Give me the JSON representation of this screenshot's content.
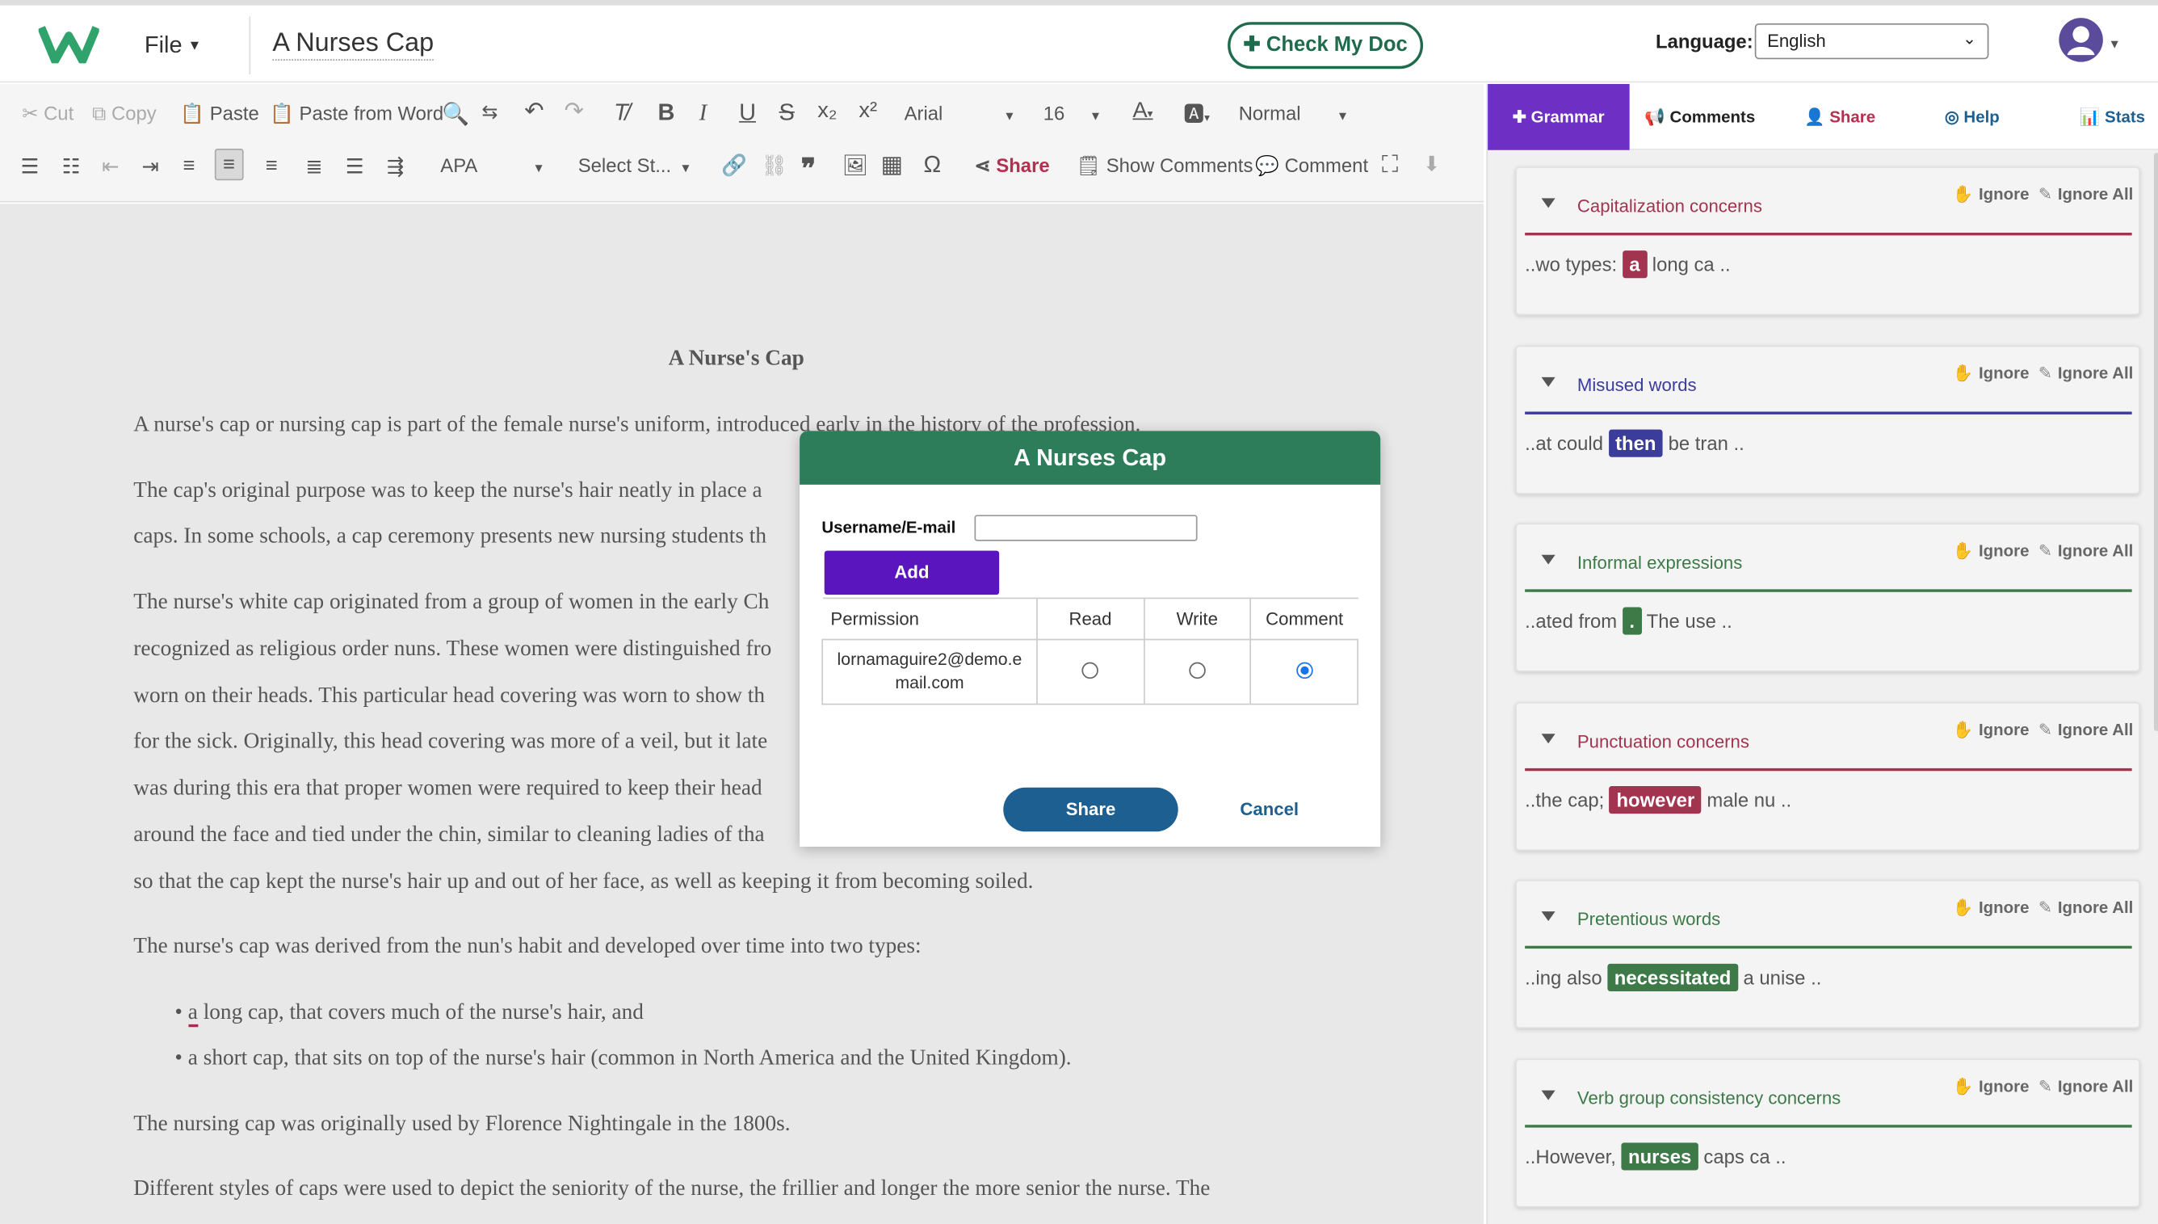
{
  "header": {
    "file_menu": "File",
    "doc_title": "A Nurses Cap",
    "check_button": "Check My Doc",
    "language_label": "Language:",
    "language_value": "English"
  },
  "toolbar": {
    "cut": "Cut",
    "copy": "Copy",
    "paste": "Paste",
    "paste_word": "Paste from Word",
    "font": "Arial",
    "size": "16",
    "style": "Normal",
    "citation": "APA",
    "select_style": "Select St...",
    "share": "Share",
    "show_comments": "Show Comments",
    "comment": "Comment"
  },
  "document": {
    "title": "A Nurse's Cap",
    "lines": [
      "A nurse's cap or nursing cap is part of the female nurse's uniform, introduced early in the history of the profession.",
      "The cap's original purpose was to keep the nurse's hair neatly in place a",
      "caps. In some schools, a cap ceremony presents new nursing students th",
      "The nurse's white cap originated from a group of women in the early Ch",
      "recognized as religious order nuns. These women were distinguished fro",
      "worn on their heads. This particular head covering was worn to show th",
      "for the sick. Originally, this head covering was more of a veil, but it late",
      "was during this era that proper women were required to keep their head",
      "around the face and tied under the chin, similar to cleaning ladies of tha",
      "so that the cap kept the nurse's hair up and out of her face, as well as keeping it from becoming soiled.",
      "The nurse's cap was derived from the nun's habit and developed over time into two types:"
    ],
    "bullet1_first": "a",
    "bullet1_rest": " long cap, that covers much of the nurse's hair, and",
    "bullet2": "a short cap, that sits on top of the nurse's hair (common in North America and the United Kingdom).",
    "line_nightingale": "The nursing cap was originally used by Florence Nightingale in the 1800s.",
    "line_last": "Different styles of caps were used to depict the seniority of the nurse, the frillier and longer the more senior the nurse. The"
  },
  "dialog": {
    "title": "A Nurses Cap",
    "username_label": "Username/E-mail",
    "username_value": "",
    "add_button": "Add",
    "columns": [
      "Permission",
      "Read",
      "Write",
      "Comment"
    ],
    "row_email": "lornamaguire2@demo.email.com",
    "row_email_line1": "lornamaguire2@demo.e",
    "row_email_line2": "mail.com",
    "selected_permission": "Comment",
    "share_button": "Share",
    "cancel_button": "Cancel"
  },
  "panel": {
    "tabs": {
      "grammar": "Grammar",
      "comments": "Comments",
      "share": "Share",
      "help": "Help",
      "stats": "Stats"
    },
    "ignore": "Ignore",
    "ignore_all": "Ignore All",
    "cards": [
      {
        "title": "Capitalization concerns",
        "before": "..wo types: ",
        "word": "a",
        "after": " long ca ..",
        "color": "#a2344f"
      },
      {
        "title": "Misused words",
        "before": "..at could ",
        "word": "then",
        "after": " be tran ..",
        "color": "#3c3c9b"
      },
      {
        "title": "Informal expressions",
        "before": "..ated from ",
        "word": ".",
        "after": " The use ..",
        "color": "#3d7a48"
      },
      {
        "title": "Punctuation concerns",
        "before": "..the cap; ",
        "word": "however",
        "after": " male nu ..",
        "color": "#a2344f"
      },
      {
        "title": "Pretentious words",
        "before": "..ing also ",
        "word": "necessitated",
        "after": " a unise ..",
        "color": "#3d7a48"
      },
      {
        "title": "Verb group consistency concerns",
        "before": "..However, ",
        "word": "nurses",
        "after": "  caps ca ..",
        "color": "#3d7a48"
      }
    ]
  },
  "colors": {
    "brand_green": "#2d7d5a",
    "accent_purple": "#6d2fc4",
    "share_blue": "#1d5f91",
    "share_red": "#b4304e"
  }
}
